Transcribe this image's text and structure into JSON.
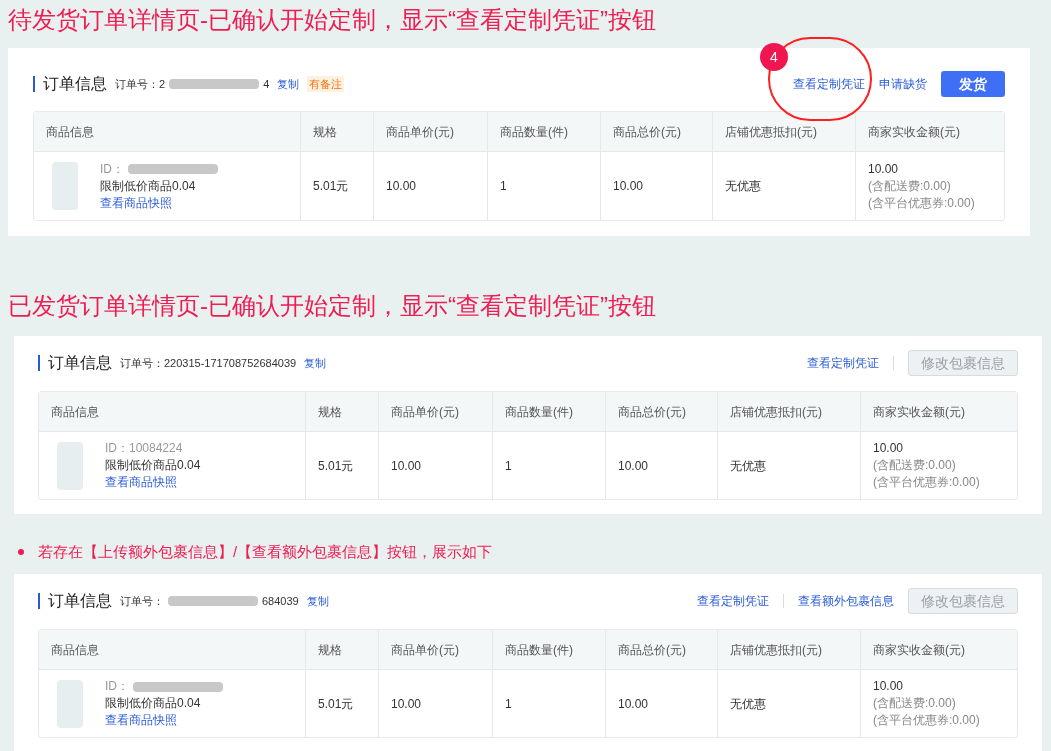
{
  "sections": [
    {
      "annotation": {
        "kind": "title",
        "text": "待发货订单详情页-已确认开始定制，显示“查看定制凭证”按钮"
      },
      "card": {
        "title": "订单信息",
        "order_label": "订单号：",
        "order_no": [
          {
            "kind": "text",
            "text": "2"
          },
          {
            "kind": "redacted"
          },
          {
            "kind": "text",
            "text": "4"
          }
        ],
        "copy": "复制",
        "note_tag": "有备注",
        "actions": [
          {
            "kind": "link",
            "label": "查看定制凭证",
            "callout": "4"
          },
          {
            "kind": "link",
            "label": "申请缺货"
          },
          {
            "kind": "primary",
            "label": "发货"
          }
        ],
        "columns": [
          "商品信息",
          "规格",
          "商品单价(元)",
          "商品数量(件)",
          "商品总价(元)",
          "店铺优惠抵扣(元)",
          "商家实收金额(元)"
        ],
        "row": {
          "id": [
            {
              "kind": "text",
              "text": "ID："
            },
            {
              "kind": "redacted"
            }
          ],
          "name": "限制低价商品0.04",
          "snapshot": "查看商品快照",
          "spec": "5.01元",
          "unit_price": "10.00",
          "quantity": "1",
          "total": "10.00",
          "discount": "无优惠",
          "received": "10.00",
          "received_notes": [
            "(含配送费:0.00)",
            "(含平台优惠券:0.00)"
          ]
        }
      }
    },
    {
      "annotation": {
        "kind": "title",
        "text": "已发货订单详情页-已确认开始定制，显示“查看定制凭证”按钮"
      },
      "card": {
        "title": "订单信息",
        "order_label": "订单号：",
        "order_no": [
          {
            "kind": "text",
            "text": "220315-171708752684039"
          }
        ],
        "copy": "复制",
        "actions": [
          {
            "kind": "link",
            "label": "查看定制凭证"
          },
          {
            "kind": "divider"
          },
          {
            "kind": "disabled",
            "label": "修改包裹信息"
          }
        ],
        "columns": [
          "商品信息",
          "规格",
          "商品单价(元)",
          "商品数量(件)",
          "商品总价(元)",
          "店铺优惠抵扣(元)",
          "商家实收金额(元)"
        ],
        "row": {
          "id": [
            {
              "kind": "text",
              "text": "ID：10084224"
            }
          ],
          "name": "限制低价商品0.04",
          "snapshot": "查看商品快照",
          "spec": "5.01元",
          "unit_price": "10.00",
          "quantity": "1",
          "total": "10.00",
          "discount": "无优惠",
          "received": "10.00",
          "received_notes": [
            "(含配送费:0.00)",
            "(含平台优惠券:0.00)"
          ]
        }
      }
    },
    {
      "annotation": {
        "kind": "bullet",
        "text": "若存在【上传额外包裹信息】/【查看额外包裹信息】按钮，展示如下"
      },
      "card": {
        "title": "订单信息",
        "order_label": "订单号：",
        "order_no": [
          {
            "kind": "redacted"
          },
          {
            "kind": "text",
            "text": "684039"
          }
        ],
        "copy": "复制",
        "actions": [
          {
            "kind": "link",
            "label": "查看定制凭证"
          },
          {
            "kind": "divider"
          },
          {
            "kind": "link",
            "label": "查看额外包裹信息"
          },
          {
            "kind": "disabled",
            "label": "修改包裹信息"
          }
        ],
        "columns": [
          "商品信息",
          "规格",
          "商品单价(元)",
          "商品数量(件)",
          "商品总价(元)",
          "店铺优惠抵扣(元)",
          "商家实收金额(元)"
        ],
        "row": {
          "id": [
            {
              "kind": "text",
              "text": "ID："
            },
            {
              "kind": "redacted"
            }
          ],
          "name": "限制低价商品0.04",
          "snapshot": "查看商品快照",
          "spec": "5.01元",
          "unit_price": "10.00",
          "quantity": "1",
          "total": "10.00",
          "discount": "无优惠",
          "received": "10.00",
          "received_notes": [
            "(含配送费:0.00)",
            "(含平台优惠券:0.00)"
          ]
        }
      }
    }
  ]
}
